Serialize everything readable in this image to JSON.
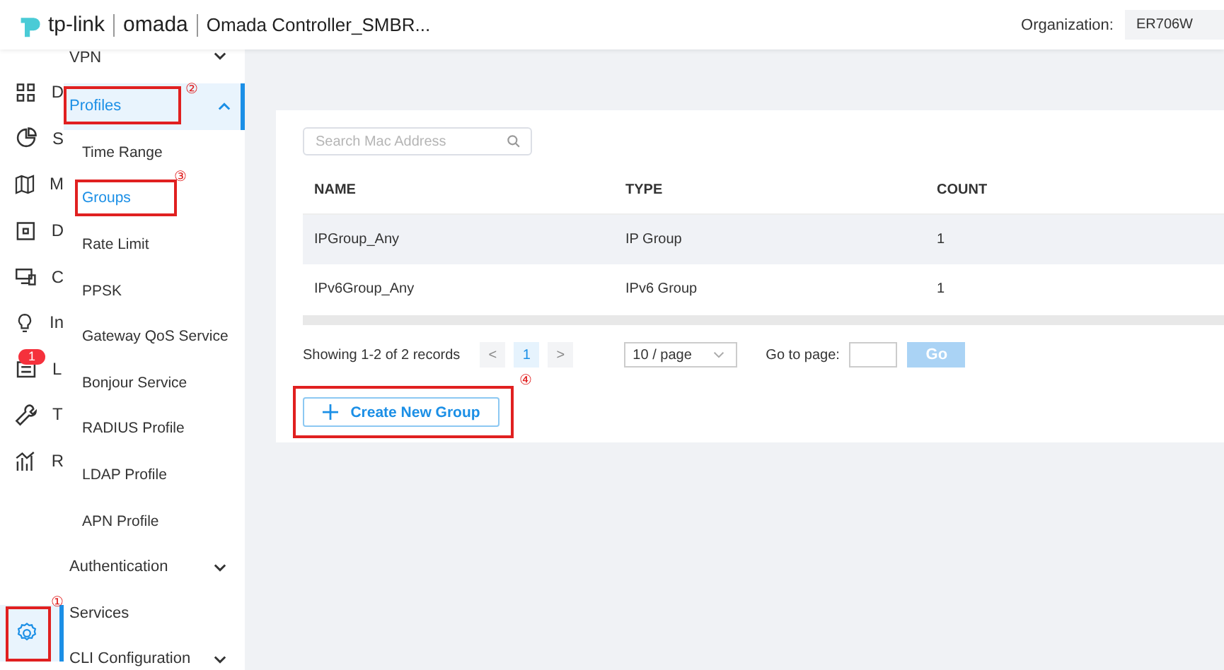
{
  "header": {
    "brand": "tp-link",
    "product": "omada",
    "title": "Omada Controller_SMBR...",
    "organization_label": "Organization:",
    "organization": "ER706W"
  },
  "rail": {
    "items": [
      {
        "label": "D"
      },
      {
        "label": "S"
      },
      {
        "label": "M"
      },
      {
        "label": "D"
      },
      {
        "label": "C"
      },
      {
        "label": "In"
      },
      {
        "label": "L",
        "badge": "1"
      },
      {
        "label": "T"
      },
      {
        "label": "R"
      }
    ],
    "settings": {
      "selected": true,
      "marker": "①"
    }
  },
  "submenu": [
    {
      "label": "VPN",
      "kind": "group",
      "expanded": false,
      "selected": false
    },
    {
      "label": "Profiles",
      "kind": "group",
      "expanded": true,
      "selected": true,
      "marker": "②",
      "children": [
        {
          "label": "Time Range",
          "selected": false
        },
        {
          "label": "Groups",
          "selected": true,
          "marker": "③"
        },
        {
          "label": "Rate Limit",
          "selected": false
        },
        {
          "label": "PPSK",
          "selected": false
        },
        {
          "label": "Gateway QoS Service",
          "selected": false
        },
        {
          "label": "Bonjour Service",
          "selected": false
        },
        {
          "label": "RADIUS Profile",
          "selected": false
        },
        {
          "label": "LDAP Profile",
          "selected": false
        },
        {
          "label": "APN Profile",
          "selected": false
        }
      ]
    },
    {
      "label": "Authentication",
      "kind": "group",
      "expanded": false,
      "selected": false
    },
    {
      "label": "Services",
      "kind": "link",
      "selected": false
    },
    {
      "label": "CLI Configuration",
      "kind": "group",
      "expanded": false,
      "selected": false
    }
  ],
  "search": {
    "placeholder": "Search Mac Address"
  },
  "table": {
    "columns": [
      "NAME",
      "TYPE",
      "COUNT"
    ],
    "rows": [
      {
        "cells": [
          "IPGroup_Any",
          "IP Group",
          "1"
        ],
        "highlighted": true
      },
      {
        "cells": [
          "IPv6Group_Any",
          "IPv6 Group",
          "1"
        ],
        "highlighted": false
      }
    ]
  },
  "pagination": {
    "summary": "Showing 1-2 of 2 records",
    "prev": "<",
    "pages": [
      {
        "label": "1",
        "selected": true
      }
    ],
    "next": ">",
    "page_size": "10 / page",
    "goto_label": "Go to page:",
    "go": "Go"
  },
  "create_button": {
    "label": "Create New Group",
    "marker": "④"
  }
}
